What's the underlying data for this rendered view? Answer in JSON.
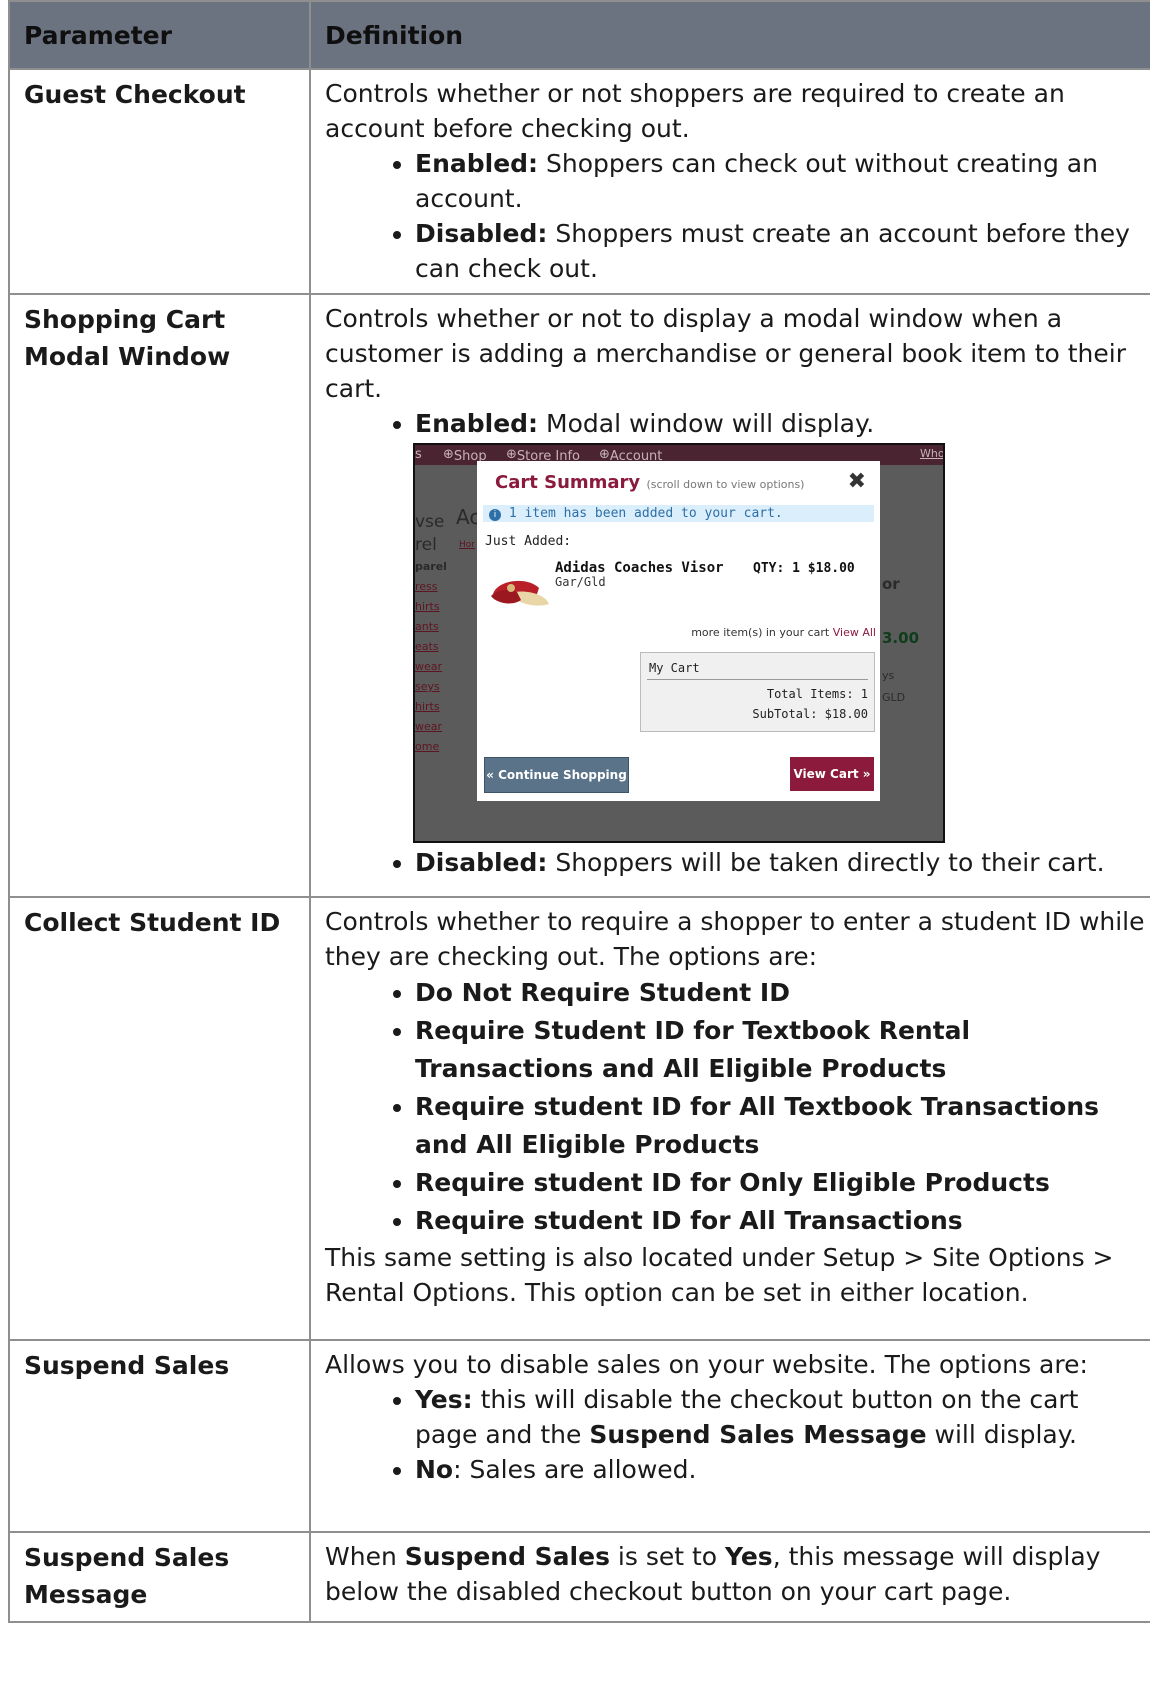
{
  "header": {
    "col1": "Parameter",
    "col2": "Definition"
  },
  "rows": {
    "guest": {
      "param": "Guest Checkout",
      "desc": "Controls whether or not shoppers are required to create an account before checking out.",
      "b1_label": "Enabled:",
      "b1_text": " Shoppers can check out without creating an account.",
      "b2_label": "Disabled:",
      "b2_text": " Shoppers must create an account before they can check out."
    },
    "modal": {
      "param": "Shopping Cart Modal Window",
      "desc": "Controls whether or not to display a modal window when a customer is adding a merchandise or general book item to their cart.",
      "b1_label": "Enabled:",
      "b1_text": " Modal window will display.",
      "b2_label": "Disabled:",
      "b2_text": " Shoppers will be taken directly to their cart."
    },
    "student": {
      "param": "Collect Student ID",
      "desc": "Controls whether to require a shopper to enter a student ID while they are checking out.  The options are:",
      "options": [
        "Do Not Require Student ID",
        "Require Student ID for Textbook Rental Transactions and All Eligible Products",
        "Require student ID for All Textbook Transactions and All Eligible Products",
        "Require student ID for Only Eligible Products",
        "Require student ID for All Transactions"
      ],
      "note": "This same setting is also located under Setup > Site Options > Rental Options.  This option can be set in either location."
    },
    "suspend": {
      "param": "Suspend Sales",
      "desc": "Allows you to disable sales on your website. The options are:",
      "b1_label": "Yes:",
      "b1_pre": " this will disable the checkout button on the cart page and the ",
      "b1_bold": "Suspend Sales Message",
      "b1_post": " will display.",
      "b2_label": "No",
      "b2_text": ": Sales are allowed."
    },
    "suspend_msg": {
      "param": "Suspend Sales Message",
      "pre": "When ",
      "bold1": "Suspend Sales",
      "mid": " is set to ",
      "bold2": "Yes",
      "post": ", this message will display below the disabled checkout button on your cart page."
    }
  },
  "screenshot": {
    "nav": {
      "left": "s",
      "shop": "Shop",
      "store": "Store Info",
      "account": "Account",
      "right": "Who"
    },
    "bg": {
      "w1": "vse",
      "w2": "rel",
      "w3": "Ac",
      "hor": "Hor",
      "parel": "parel",
      "or": "or",
      "price": "3.00",
      "ys": "ys",
      "gld": "GLD"
    },
    "bg_links": [
      "ress",
      "hirts",
      "ants",
      "eats",
      "wear",
      "seys",
      "hirts",
      "wear",
      "ome"
    ],
    "title": "Cart Summary",
    "title_sub": "(scroll down to view options)",
    "close": "✖",
    "info_icon": "i",
    "info": "1 item has been added to your cart.",
    "just_added": "Just Added:",
    "item": "Adidas Coaches Visor",
    "qty": "QTY: 1  $18.00",
    "color": "Gar/Gld",
    "more_text": "more item(s) in your cart",
    "view_all": "View All",
    "cart_header": "My Cart",
    "total_items": "Total Items: 1",
    "subtotal": "SubTotal: $18.00",
    "continue": "« Continue Shopping",
    "view_cart": "View Cart »"
  }
}
